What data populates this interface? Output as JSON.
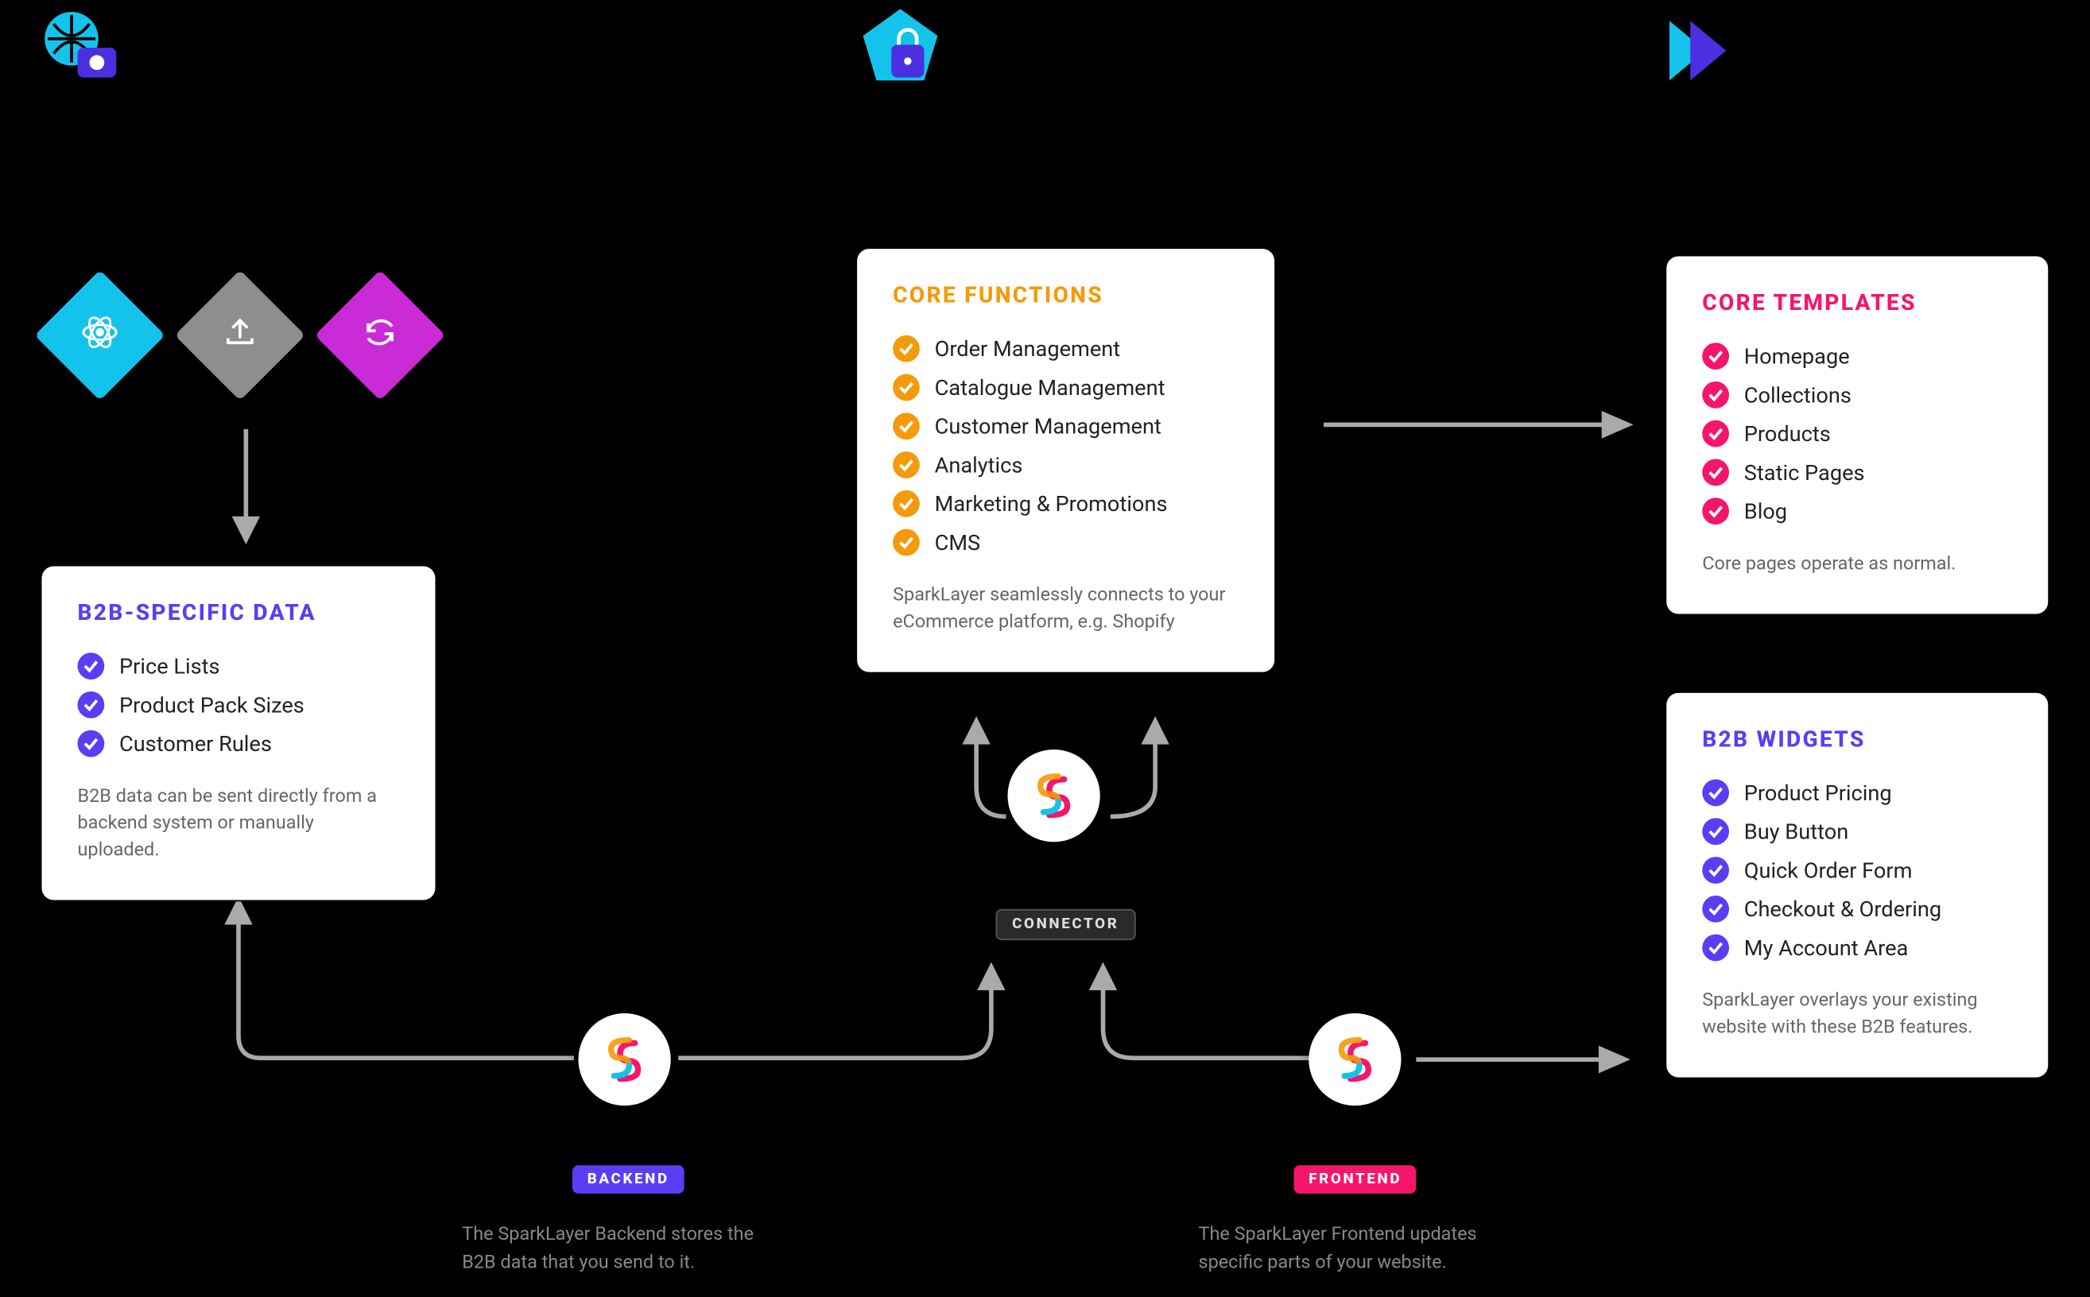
{
  "header_icons": [
    "globe-camera-icon",
    "shield-lock-icon",
    "play-forward-icon"
  ],
  "diamonds": [
    {
      "color": "#14C3EB",
      "icon": "atom-icon"
    },
    {
      "color": "#8E8E8E",
      "icon": "upload-icon"
    },
    {
      "color": "#C92BD6",
      "icon": "sync-icon"
    }
  ],
  "b2b": {
    "title": "B2B-SPECIFIC DATA",
    "items": [
      "Price Lists",
      "Product Pack Sizes",
      "Customer Rules"
    ],
    "note": "B2B data can be sent directly from a backend system or manually uploaded."
  },
  "core": {
    "title": "CORE FUNCTIONS",
    "items": [
      "Order Management",
      "Catalogue Management",
      "Customer Management",
      "Analytics",
      "Marketing & Promotions",
      "CMS"
    ],
    "note": "SparkLayer seamlessly connects to your eCommerce platform, e.g. Shopify"
  },
  "templates": {
    "title": "CORE TEMPLATES",
    "items": [
      "Homepage",
      "Collections",
      "Products",
      "Static Pages",
      "Blog"
    ],
    "note": "Core pages operate as normal."
  },
  "widgets": {
    "title": "B2B WIDGETS",
    "items": [
      "Product Pricing",
      "Buy Button",
      "Quick Order Form",
      "Checkout & Ordering",
      "My Account Area"
    ],
    "note": "SparkLayer overlays your existing website with these B2B features."
  },
  "badges": {
    "connector": "CONNECTOR",
    "backend": "BACKEND",
    "frontend": "FRONTEND"
  },
  "captions": {
    "backend": "The SparkLayer Backend stores the B2B data that you send to it.",
    "frontend": "The SparkLayer Frontend updates specific parts of your website."
  }
}
